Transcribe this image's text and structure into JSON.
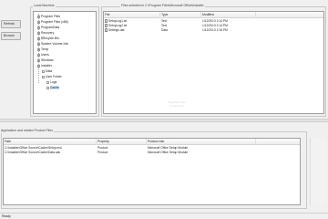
{
  "left_buttons": {
    "button_1": "Refresh",
    "button_2": "Browse"
  },
  "tree_panel": {
    "legend": "Local Machine",
    "items": [
      {
        "label": "Program Files",
        "level": 0
      },
      {
        "label": "Program Files (x86)",
        "level": 0
      },
      {
        "label": "ProgramData",
        "level": 0
      },
      {
        "label": "Recovery",
        "level": 0
      },
      {
        "label": "$Recycle.Bin",
        "level": 0
      },
      {
        "label": "System Volume Info",
        "level": 0
      },
      {
        "label": "Temp",
        "level": 0
      },
      {
        "label": "Users",
        "level": 0
      },
      {
        "label": "Windows",
        "level": 0
      },
      {
        "label": "Installer",
        "level": 0
      },
      {
        "label": "Data",
        "level": 1
      },
      {
        "label": "User Folder",
        "level": 1
      },
      {
        "label": "Logs",
        "level": 2
      },
      {
        "label": "Cache",
        "level": 2
      }
    ]
  },
  "files_panel": {
    "legend": "Files selected in C:\\Program Files\\Microsoft Office\\Installer",
    "columns": [
      "File",
      "Type",
      "Modified"
    ],
    "rows": [
      {
        "name": "SetupLog1.txt",
        "type": "Text",
        "modified": "1/12/2013 2:14 PM"
      },
      {
        "name": "SetupLog2.txt",
        "type": "Text",
        "modified": "1/12/2013 2:14 PM"
      },
      {
        "name": "Settings.dat",
        "type": "Data",
        "modified": "1/12/2013 2:16 PM"
      }
    ],
    "watermark": [
      "Drag files here",
      "to add them"
    ]
  },
  "results_panel": {
    "legend": "Application and related Product Files",
    "columns": [
      "Path",
      "Property",
      "Product Info"
    ],
    "rows": [
      {
        "path": "C:\\Installer\\Office Source\\Cache\\Setup.msi",
        "property": "Product",
        "info": "Microsoft Office Setup Module"
      },
      {
        "path": "C:\\Installer\\Office Source\\Cache\\Data.cab",
        "property": "Product",
        "info": "Microsoft Office Setup Module"
      }
    ]
  },
  "status_bar": {
    "text": "Ready"
  }
}
